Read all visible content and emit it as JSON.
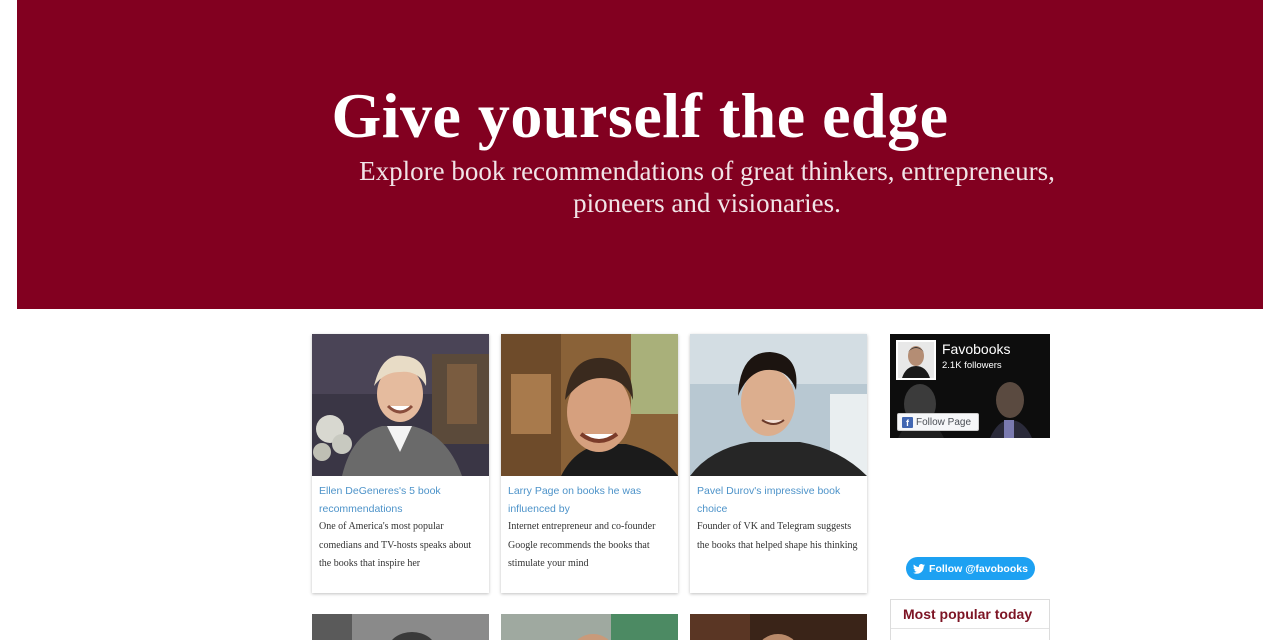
{
  "hero": {
    "title": "Give yourself the edge",
    "subtitle": "Explore book recommendations of great thinkers, entrepreneurs, pioneers and visionaries.",
    "background": "#820020"
  },
  "cards": [
    {
      "title": "Ellen DeGeneres's 5 book recommendations",
      "description": "One of America's most popular comedians and TV-hosts speaks about the books that inspire her"
    },
    {
      "title": "Larry Page on books he was influenced by",
      "description": "Internet entrepreneur and co-founder Google recommends the books that stimulate your mind"
    },
    {
      "title": "Pavel Durov's impressive book choice",
      "description": "Founder of VK and Telegram suggests the books that helped shape his thinking"
    }
  ],
  "sidebar": {
    "facebook": {
      "page_name": "Favobooks",
      "followers": "2.1K followers",
      "follow_label": "Follow Page"
    },
    "twitter": {
      "follow_label": "Follow @favobooks",
      "color": "#1da1f2"
    },
    "popular": {
      "heading": "Most popular today"
    }
  },
  "colors": {
    "link": "#4d93c9",
    "brand": "#820020"
  }
}
